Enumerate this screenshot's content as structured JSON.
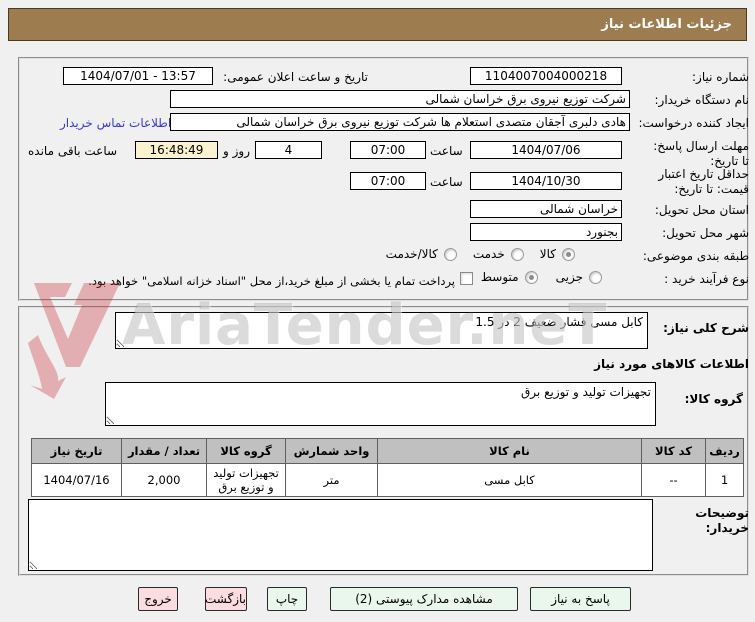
{
  "title": "جزئیات اطلاعات نیاز",
  "watermark": {
    "text": "AriaTender.neT"
  },
  "form": {
    "need_number": {
      "label": "شماره نیاز:",
      "value": "1104007004000218"
    },
    "announce": {
      "label": "تاریخ و ساعت اعلان عمومی:",
      "value": "1404/07/01 - 13:57"
    },
    "buyer_org": {
      "label": "نام دستگاه خریدار:",
      "value": "شرکت توزیع نیروی برق خراسان شمالی"
    },
    "creator": {
      "label": "ایجاد کننده درخواست:",
      "value": "هادی دلبری آجقان متصدی استعلام ها شرکت توزیع نیروی برق خراسان شمالی",
      "contact_link": "اطلاعات تماس خریدار"
    },
    "deadline": {
      "label": "مهلت ارسال پاسخ: تا تاریخ:",
      "date": "1404/07/06",
      "hour_label": "ساعت",
      "time": "07:00",
      "days": "4",
      "days_label": "روز و",
      "remaining": "16:48:49",
      "remaining_label": "ساعت باقی مانده"
    },
    "validity": {
      "label": "حداقل تاریخ اعتبار قیمت: تا تاریخ:",
      "date": "1404/10/30",
      "hour_label": "ساعت",
      "time": "07:00"
    },
    "province": {
      "label": "استان محل تحویل:",
      "value": "خراسان شمالی"
    },
    "city": {
      "label": "شهر محل تحویل:",
      "value": "بجنورد"
    },
    "classification": {
      "label": "طبقه بندی موضوعی:",
      "options": [
        "کالا",
        "خدمت",
        "کالا/خدمت"
      ],
      "selected": "کالا"
    },
    "process": {
      "label": "نوع فرآیند خرید :",
      "options": [
        "جزیی",
        "متوسط"
      ],
      "selected": "متوسط",
      "treasury_note": "پرداخت تمام یا بخشی از مبلغ خرید،از محل \"اسناد خزانه اسلامی\" خواهد بود."
    }
  },
  "need_desc": {
    "label": "شرح کلی نیاز:",
    "value": "کابل مسی فشار ضعیف 2 در 1.5"
  },
  "goods": {
    "heading": "اطلاعات کالاهای مورد نیاز",
    "group_label": "گروه کالا:",
    "group_value": "تجهیزات تولید و توزیع برق"
  },
  "table": {
    "headers": [
      "ردیف",
      "کد کالا",
      "نام کالا",
      "واحد شمارش",
      "گروه کالا",
      "تعداد / مقدار",
      "تاریخ نیاز"
    ],
    "rows": [
      [
        "1",
        "--",
        "کابل مسی",
        "متر",
        "تجهیزات تولید و توزیع برق",
        "2,000",
        "1404/07/16"
      ]
    ]
  },
  "buyer_notes": {
    "label": "توضیحات خریدار:",
    "value": ""
  },
  "buttons": {
    "respond": "پاسخ به نیاز",
    "attachments": "مشاهده مدارک پیوستی (2)",
    "print": "چاپ",
    "back": "بازگشت",
    "exit": "خروج"
  },
  "colors": {
    "accent_brown": "#9d7c4f",
    "button_green": "#e9f7ec",
    "button_pink": "#fbdce1",
    "remaining_bg": "#fbf3cf",
    "link_blue": "#3a3ace",
    "table_header_bg": "#c0c0c0"
  }
}
